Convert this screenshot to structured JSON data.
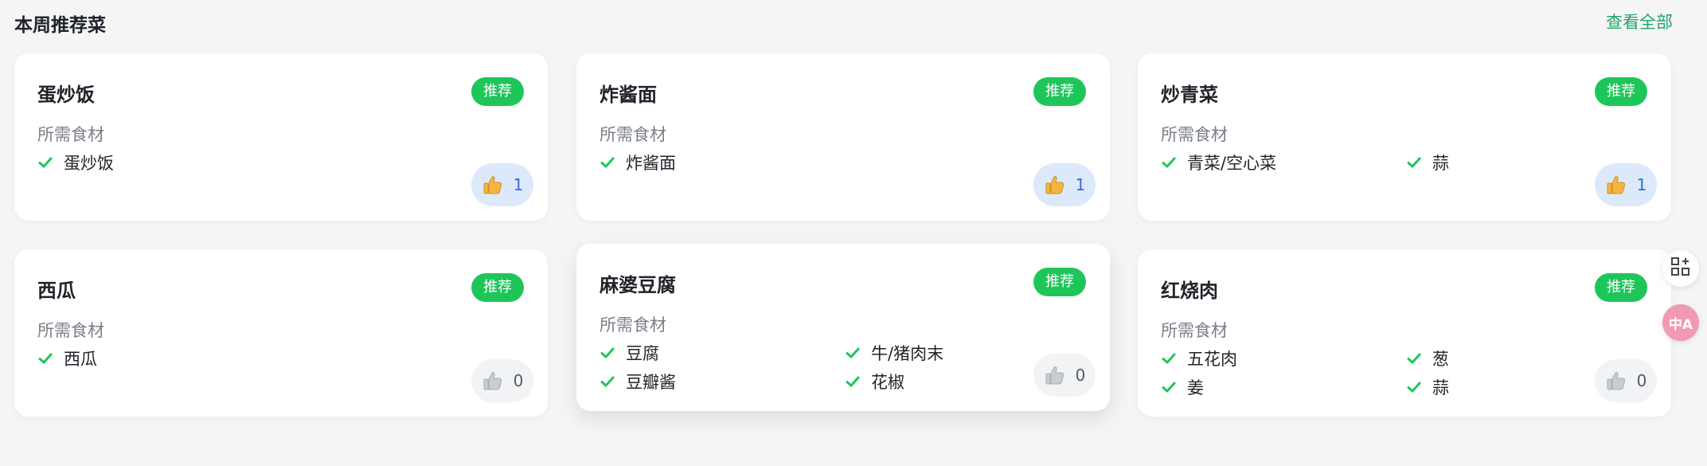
{
  "section": {
    "title": "本周推荐菜",
    "view_all": "查看全部"
  },
  "colors": {
    "accent_green": "#1ec65a",
    "link_green": "#1fa46a",
    "liked_bg": "#dce9fb",
    "liked_text": "#2f6fd8"
  },
  "cards": [
    {
      "name": "蛋炒饭",
      "badge": "推荐",
      "ingredients_label": "所需食材",
      "ingredients": [
        "蛋炒饭"
      ],
      "likes": "1",
      "liked": true
    },
    {
      "name": "炸酱面",
      "badge": "推荐",
      "ingredients_label": "所需食材",
      "ingredients": [
        "炸酱面"
      ],
      "likes": "1",
      "liked": true
    },
    {
      "name": "炒青菜",
      "badge": "推荐",
      "ingredients_label": "所需食材",
      "ingredients": [
        "青菜/空心菜",
        "蒜"
      ],
      "likes": "1",
      "liked": true
    },
    {
      "name": "西瓜",
      "badge": "推荐",
      "ingredients_label": "所需食材",
      "ingredients": [
        "西瓜"
      ],
      "likes": "0",
      "liked": false
    },
    {
      "name": "麻婆豆腐",
      "badge": "推荐",
      "ingredients_label": "所需食材",
      "ingredients": [
        "豆腐",
        "牛/猪肉末",
        "豆瓣酱",
        "花椒"
      ],
      "likes": "0",
      "liked": false
    },
    {
      "name": "红烧肉",
      "badge": "推荐",
      "ingredients_label": "所需食材",
      "ingredients": [
        "五花肉",
        "葱",
        "姜",
        "蒜"
      ],
      "likes": "0",
      "liked": false
    }
  ],
  "icons": {
    "check": "check-icon",
    "thumb": "thumbs-up-icon",
    "float_apps": "apps-add-icon",
    "float_translate": "translate-icon"
  },
  "float_translate_label": "中A"
}
